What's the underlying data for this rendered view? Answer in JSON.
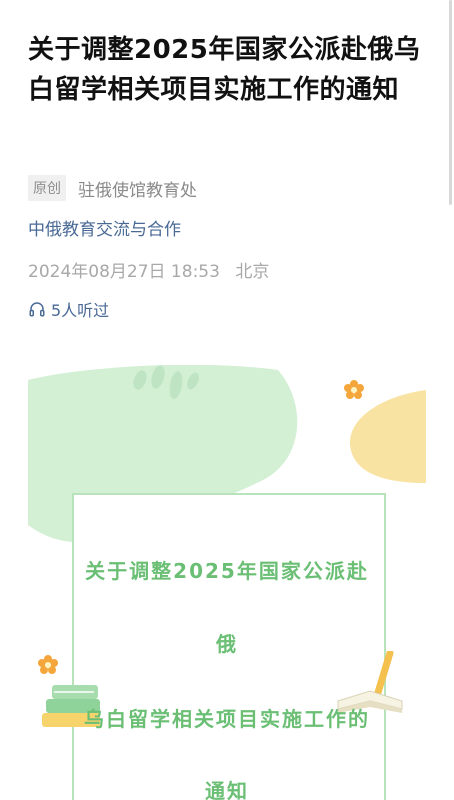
{
  "article": {
    "title": "关于调整2025年国家公派赴俄乌白留学相关项目实施工作的通知",
    "original_tag": "原创",
    "author": "驻俄使馆教育处",
    "collection": "中俄教育交流与合作",
    "date": "2024年08月27日 18:53",
    "location": "北京",
    "listen_count": "5人听过"
  },
  "poster": {
    "lines": [
      "关于调整2025年国家公派赴",
      "俄",
      "乌白留学相关项目实施工作的",
      "通知"
    ]
  },
  "colors": {
    "title_text": "#111111",
    "link_blue": "#4a6a96",
    "meta_gray": "#a8a8a8",
    "poster_green": "#6bbf75",
    "poster_yellow": "#f9e3a2",
    "poster_light_green": "#d3f0d5"
  },
  "icons": {
    "listen": "headphones-icon"
  }
}
